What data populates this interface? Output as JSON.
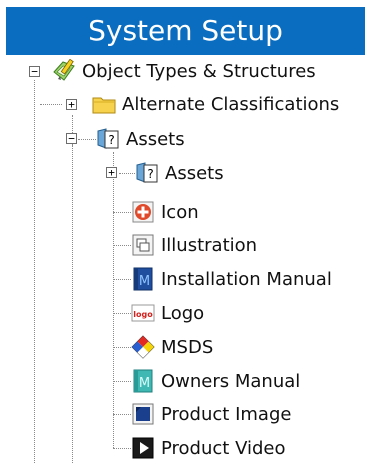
{
  "header": {
    "title": "System Setup"
  },
  "tree": {
    "root": {
      "label": "Object Types & Structures",
      "expander": "−",
      "icon": "object-types-icon"
    },
    "level1": [
      {
        "label": "Alternate Classifications",
        "expander": "+",
        "icon": "folder-icon"
      },
      {
        "label": "Assets",
        "expander": "−",
        "icon": "assets-icon"
      }
    ],
    "assets_children": [
      {
        "label": "Assets",
        "expander": "+",
        "icon": "assets-icon"
      },
      {
        "label": "Icon",
        "icon": "icon-type-icon"
      },
      {
        "label": "Illustration",
        "icon": "illustration-icon"
      },
      {
        "label": "Installation Manual",
        "icon": "installation-manual-icon"
      },
      {
        "label": "Logo",
        "icon": "logo-icon"
      },
      {
        "label": "MSDS",
        "icon": "msds-icon"
      },
      {
        "label": "Owners Manual",
        "icon": "owners-manual-icon"
      },
      {
        "label": "Product Image",
        "icon": "product-image-icon"
      },
      {
        "label": "Product Video",
        "icon": "product-video-icon"
      }
    ]
  },
  "colors": {
    "header_bg": "#0a6dbf",
    "header_text": "#ffffff"
  }
}
